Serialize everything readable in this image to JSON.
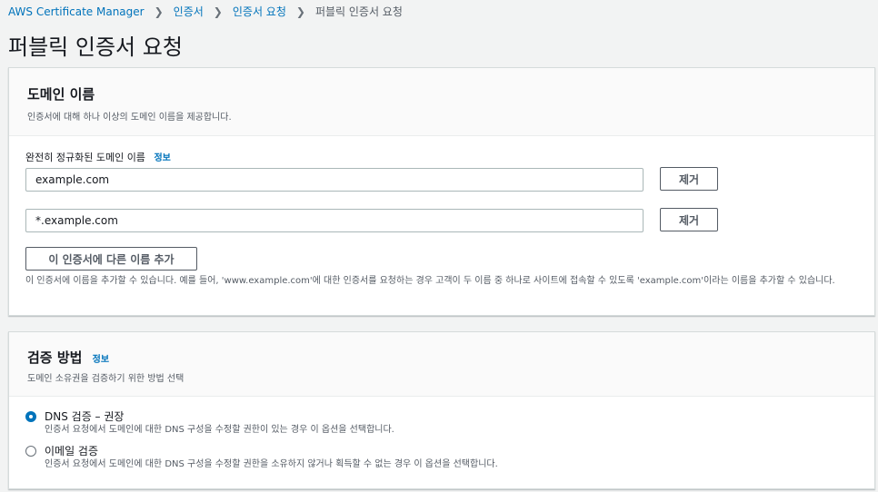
{
  "breadcrumb": {
    "items": [
      "AWS Certificate Manager",
      "인증서",
      "인증서 요청"
    ],
    "current": "퍼블릭 인증서 요청",
    "separator": "❯"
  },
  "page_title": "퍼블릭 인증서 요청",
  "domain_section": {
    "title": "도메인 이름",
    "description": "인증서에 대해 하나 이상의 도메인 이름을 제공합니다.",
    "field_label": "완전히 정규화된 도메인 이름",
    "info_label": "정보",
    "domains": [
      {
        "value": "example.com",
        "remove_label": "제거"
      },
      {
        "value": "*.example.com",
        "remove_label": "제거"
      }
    ],
    "add_button_label": "이 인증서에 다른 이름 추가",
    "help_text": "이 인증서에 이름을 추가할 수 있습니다. 예를 들어, 'www.example.com'에 대한 인증서를 요청하는 경우 고객이 두 이름 중 하나로 사이트에 접속할 수 있도록 'example.com'이라는 이름을 추가할 수 있습니다."
  },
  "validation_section": {
    "title": "검증 방법",
    "info_label": "정보",
    "description": "도메인 소유권을 검증하기 위한 방법 선택",
    "options": [
      {
        "label": "DNS 검증 – 권장",
        "description": "인증서 요청에서 도메인에 대한 DNS 구성을 수정할 권한이 있는 경우 이 옵션을 선택합니다.",
        "selected": true
      },
      {
        "label": "이메일 검증",
        "description": "인증서 요청에서 도메인에 대한 DNS 구성을 수정할 권한을 소유하지 않거나 획득할 수 없는 경우 이 옵션을 선택합니다.",
        "selected": false
      }
    ]
  },
  "colors": {
    "link": "#0073bb",
    "background": "#f2f3f3",
    "text": "#16191f",
    "muted": "#545b64"
  }
}
